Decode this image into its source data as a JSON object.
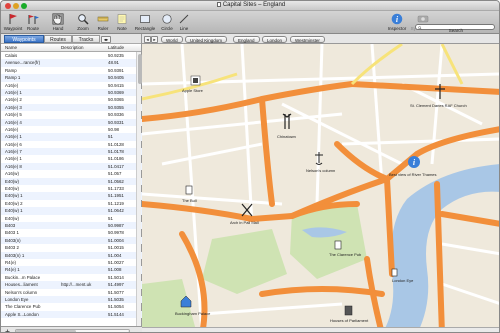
{
  "window": {
    "title": "Capital Sites  –  England"
  },
  "toolbar": {
    "tools": [
      {
        "label": "Waypoint",
        "icon": "waypoint-flag-icon"
      },
      {
        "label": "Route",
        "icon": "route-flags-icon"
      },
      {
        "label": "Hand",
        "icon": "hand-icon"
      },
      {
        "label": "Zoom",
        "icon": "magnifier-icon"
      },
      {
        "label": "Ruler",
        "icon": "ruler-icon"
      },
      {
        "label": "Note",
        "icon": "note-icon"
      },
      {
        "label": "Rectangle",
        "icon": "rectangle-icon"
      },
      {
        "label": "Circle",
        "icon": "circle-icon"
      },
      {
        "label": "Line",
        "icon": "line-icon"
      }
    ],
    "inspector_label": "Inspector",
    "synchronize_label": "Synchronize",
    "search_label": "Search",
    "search_placeholder": ""
  },
  "sidebar": {
    "tabs": [
      "Waypoints",
      "Routes",
      "Tracks"
    ],
    "columns": [
      "Name",
      "Description",
      "Latitude"
    ],
    "rows": [
      {
        "name": "Calais",
        "desc": "",
        "lat": "50.9235"
      },
      {
        "name": "Avenue...rance(fr)",
        "desc": "",
        "lat": "48.91"
      },
      {
        "name": "Ramp",
        "desc": "",
        "lat": "50.9391"
      },
      {
        "name": "Ramp 1",
        "desc": "",
        "lat": "50.9405"
      },
      {
        "name": "A16(e)",
        "desc": "",
        "lat": "50.9415"
      },
      {
        "name": "A16(e) 1",
        "desc": "",
        "lat": "50.9369"
      },
      {
        "name": "A16(e) 2",
        "desc": "",
        "lat": "50.9365"
      },
      {
        "name": "A16(e) 3",
        "desc": "",
        "lat": "50.9355"
      },
      {
        "name": "A16(e) 5",
        "desc": "",
        "lat": "50.9336"
      },
      {
        "name": "A16(e) 4",
        "desc": "",
        "lat": "50.9331"
      },
      {
        "name": "A16(e)",
        "desc": "",
        "lat": "50.98"
      },
      {
        "name": "A16(e) 1",
        "desc": "",
        "lat": "51"
      },
      {
        "name": "A16(e) 6",
        "desc": "",
        "lat": "51.0128"
      },
      {
        "name": "A16(e) 7",
        "desc": "",
        "lat": "51.0178"
      },
      {
        "name": "A16(e) 1",
        "desc": "",
        "lat": "51.0186"
      },
      {
        "name": "A16(e) 8",
        "desc": "",
        "lat": "51.0417"
      },
      {
        "name": "A16(w)",
        "desc": "",
        "lat": "51.057"
      },
      {
        "name": "E40(w)",
        "desc": "",
        "lat": "51.0562"
      },
      {
        "name": "E40(w)",
        "desc": "",
        "lat": "51.1733"
      },
      {
        "name": "E40(w) 1",
        "desc": "",
        "lat": "51.1951"
      },
      {
        "name": "E40(w) 2",
        "desc": "",
        "lat": "51.1219"
      },
      {
        "name": "E40(w) 1",
        "desc": "",
        "lat": "51.0642"
      },
      {
        "name": "E40(w)",
        "desc": "",
        "lat": "51"
      },
      {
        "name": "B403",
        "desc": "",
        "lat": "50.9987"
      },
      {
        "name": "B403 1",
        "desc": "",
        "lat": "50.9978"
      },
      {
        "name": "B403(n)",
        "desc": "",
        "lat": "51.0004"
      },
      {
        "name": "B403 2",
        "desc": "",
        "lat": "51.0015"
      },
      {
        "name": "B403(n) 1",
        "desc": "",
        "lat": "51.004"
      },
      {
        "name": "R4(e)",
        "desc": "",
        "lat": "51.0027"
      },
      {
        "name": "R4(e) 1",
        "desc": "",
        "lat": "51.008"
      },
      {
        "name": "Buckin...m Palace",
        "desc": "",
        "lat": "51.5014"
      },
      {
        "name": "Houses...liament",
        "desc": "http://...ment.uk",
        "lat": "51.4997"
      },
      {
        "name": "Nelson's column",
        "desc": "",
        "lat": "51.5077"
      },
      {
        "name": "London Eye",
        "desc": "",
        "lat": "51.5035"
      },
      {
        "name": "The Clarence Pub",
        "desc": "",
        "lat": "51.5054"
      },
      {
        "name": "Apple S...London",
        "desc": "",
        "lat": "51.5144"
      }
    ]
  },
  "breadcrumb": [
    "World",
    "United Kingdom",
    "England",
    "London",
    "Westminster"
  ],
  "map": {
    "pois": [
      {
        "label": "Apple Store"
      },
      {
        "label": "Chinatown"
      },
      {
        "label": "Nelson's column"
      },
      {
        "label": "The Bull"
      },
      {
        "label": "Arch in Pall Mall"
      },
      {
        "label": "The Clarence Pub"
      },
      {
        "label": "London Eye"
      },
      {
        "label": "Buckingham Palace"
      },
      {
        "label": "Houses of Parliament"
      },
      {
        "label": "St. Clement Danes RAF Church"
      },
      {
        "label": "Best view of River Thames"
      }
    ]
  }
}
